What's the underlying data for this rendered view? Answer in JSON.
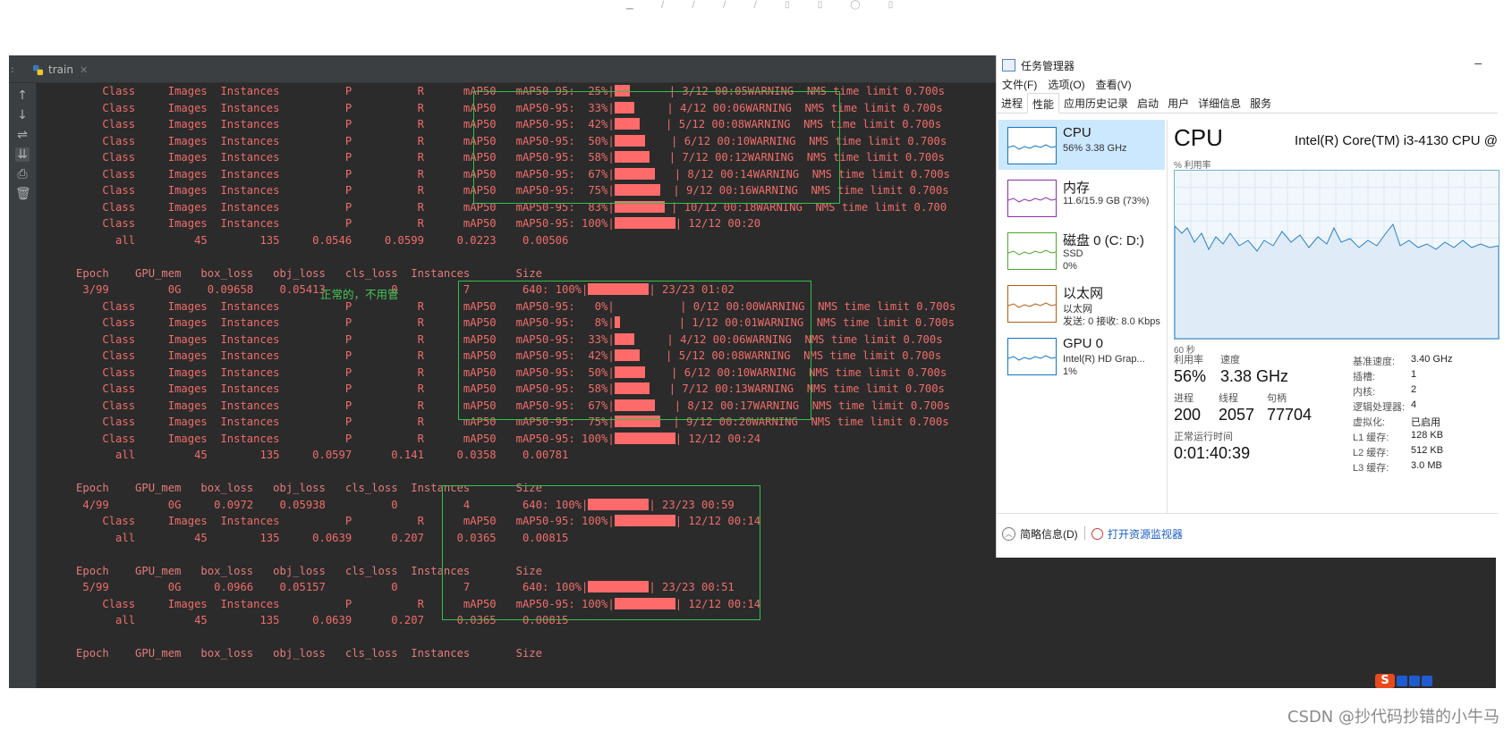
{
  "ide": {
    "tab_label": "train",
    "gutter_icons": [
      "arrow-up-icon",
      "arrow-down-icon",
      "soft-wrap-icon",
      "scroll-to-end-icon",
      "print-icon",
      "trash-icon"
    ]
  },
  "console": {
    "lines": [
      {
        "text": "          Class     Images  Instances          P          R      mAP50   mAP50-95:  25%|",
        "bar": 20,
        "after": "      | 3/12 00:05WARNING  NMS time limit 0.700s"
      },
      {
        "text": "          Class     Images  Instances          P          R      mAP50   mAP50-95:  33%|",
        "bar": 26,
        "after": "     | 4/12 00:06WARNING  NMS time limit 0.700s"
      },
      {
        "text": "          Class     Images  Instances          P          R      mAP50   mAP50-95:  42%|",
        "bar": 33,
        "after": "    | 5/12 00:08WARNING  NMS time limit 0.700s"
      },
      {
        "text": "          Class     Images  Instances          P          R      mAP50   mAP50-95:  50%|",
        "bar": 40,
        "after": "    | 6/12 00:10WARNING  NMS time limit 0.700s"
      },
      {
        "text": "          Class     Images  Instances          P          R      mAP50   mAP50-95:  58%|",
        "bar": 46,
        "after": "   | 7/12 00:12WARNING  NMS time limit 0.700s"
      },
      {
        "text": "          Class     Images  Instances          P          R      mAP50   mAP50-95:  67%|",
        "bar": 53,
        "after": "   | 8/12 00:14WARNING  NMS time limit 0.700s"
      },
      {
        "text": "          Class     Images  Instances          P          R      mAP50   mAP50-95:  75%|",
        "bar": 60,
        "after": "  | 9/12 00:16WARNING  NMS time limit 0.700s"
      },
      {
        "text": "          Class     Images  Instances          P          R      mAP50   mAP50-95:  83%|",
        "bar": 66,
        "after": " | 10/12 00:18WARNING  NMS time limit 0.700"
      },
      {
        "text": "          Class     Images  Instances          P          R      mAP50   mAP50-95: 100%|",
        "bar": 80,
        "after": "| 12/12 00:20"
      },
      {
        "text": "            all         45        135     0.0546     0.0599     0.0223    0.00506",
        "bar": 0,
        "after": ""
      },
      {
        "text": "",
        "bar": 0,
        "after": ""
      },
      {
        "text": "      Epoch    GPU_mem   box_loss   obj_loss   cls_loss  Instances       Size",
        "bar": 0,
        "after": "",
        "head": true
      },
      {
        "text": "       3/99         0G    0.09658    0.05413          0          7        640: 100%|",
        "bar": 80,
        "after": "| 23/23 01:02"
      },
      {
        "text": "          Class     Images  Instances          P          R      mAP50   mAP50-95:   0%|",
        "bar": 0,
        "after": "          | 0/12 00:00WARNING  NMS time limit 0.700s"
      },
      {
        "text": "          Class     Images  Instances          P          R      mAP50   mAP50-95:   8%|",
        "bar": 7,
        "after": "         | 1/12 00:01WARNING  NMS time limit 0.700s"
      },
      {
        "text": "          Class     Images  Instances          P          R      mAP50   mAP50-95:  33%|",
        "bar": 26,
        "after": "     | 4/12 00:06WARNING  NMS time limit 0.700s"
      },
      {
        "text": "          Class     Images  Instances          P          R      mAP50   mAP50-95:  42%|",
        "bar": 33,
        "after": "    | 5/12 00:08WARNING  NMS time limit 0.700s"
      },
      {
        "text": "          Class     Images  Instances          P          R      mAP50   mAP50-95:  50%|",
        "bar": 40,
        "after": "    | 6/12 00:10WARNING  NMS time limit 0.700s"
      },
      {
        "text": "          Class     Images  Instances          P          R      mAP50   mAP50-95:  58%|",
        "bar": 46,
        "after": "   | 7/12 00:13WARNING  NMS time limit 0.700s"
      },
      {
        "text": "          Class     Images  Instances          P          R      mAP50   mAP50-95:  67%|",
        "bar": 53,
        "after": "   | 8/12 00:17WARNING  NMS time limit 0.700s"
      },
      {
        "text": "          Class     Images  Instances          P          R      mAP50   mAP50-95:  75%|",
        "bar": 60,
        "after": "  | 9/12 00:20WARNING  NMS time limit 0.700s"
      },
      {
        "text": "          Class     Images  Instances          P          R      mAP50   mAP50-95: 100%|",
        "bar": 80,
        "after": "| 12/12 00:24"
      },
      {
        "text": "            all         45        135     0.0597      0.141     0.0358    0.00781",
        "bar": 0,
        "after": ""
      },
      {
        "text": "",
        "bar": 0,
        "after": ""
      },
      {
        "text": "      Epoch    GPU_mem   box_loss   obj_loss   cls_loss  Instances       Size",
        "bar": 0,
        "after": "",
        "head": true
      },
      {
        "text": "       4/99         0G     0.0972    0.05938          0          4        640: 100%|",
        "bar": 80,
        "after": "| 23/23 00:59"
      },
      {
        "text": "          Class     Images  Instances          P          R      mAP50   mAP50-95: 100%|",
        "bar": 80,
        "after": "| 12/12 00:14"
      },
      {
        "text": "            all         45        135     0.0639      0.207     0.0365    0.00815",
        "bar": 0,
        "after": ""
      },
      {
        "text": "",
        "bar": 0,
        "after": ""
      },
      {
        "text": "      Epoch    GPU_mem   box_loss   obj_loss   cls_loss  Instances       Size",
        "bar": 0,
        "after": "",
        "head": true
      },
      {
        "text": "       5/99         0G     0.0966    0.05157          0          7        640: 100%|",
        "bar": 80,
        "after": "| 23/23 00:51"
      },
      {
        "text": "          Class     Images  Instances          P          R      mAP50   mAP50-95: 100%|",
        "bar": 80,
        "after": "| 12/12 00:14"
      },
      {
        "text": "            all         45        135     0.0639      0.207     0.0365    0.00815",
        "bar": 0,
        "after": ""
      },
      {
        "text": "",
        "bar": 0,
        "after": ""
      },
      {
        "text": "      Epoch    GPU_mem   box_loss   obj_loss   cls_loss  Instances       Size",
        "bar": 0,
        "after": "",
        "head": true
      }
    ],
    "annotation": "正常的，不用管"
  },
  "task_manager": {
    "title": "任务管理器",
    "menu": [
      "文件(F)",
      "选项(O)",
      "查看(V)"
    ],
    "tabs": [
      "进程",
      "性能",
      "应用历史记录",
      "启动",
      "用户",
      "详细信息",
      "服务"
    ],
    "active_tab": "性能",
    "resources": [
      {
        "name": "CPU",
        "line2": "56% 3.38 GHz",
        "line3": "",
        "color": "#1174c3",
        "active": true
      },
      {
        "name": "内存",
        "line2": "11.6/15.9 GB (73%)",
        "line3": "",
        "color": "#8b2fa8",
        "active": false
      },
      {
        "name": "磁盘 0 (C: D:)",
        "line2": "SSD",
        "line3": "0%",
        "color": "#4ca82a",
        "active": false
      },
      {
        "name": "以太网",
        "line2": "以太网",
        "line3": "发送: 0 接收: 8.0 Kbps",
        "color": "#b35a12",
        "active": false
      },
      {
        "name": "GPU 0",
        "line2": "Intel(R) HD Grap...",
        "line3": "1%",
        "color": "#1174c3",
        "active": false
      }
    ],
    "cpu": {
      "heading": "CPU",
      "model": "Intel(R) Core(TM) i3-4130 CPU @",
      "util_label": "% 利用率",
      "seconds_label": "60 秒",
      "stats": {
        "util_label": "利用率",
        "util": "56%",
        "speed_label": "速度",
        "speed": "3.38 GHz",
        "proc_label": "进程",
        "proc": "200",
        "thread_label": "线程",
        "thread": "2057",
        "handle_label": "句柄",
        "handle": "77704",
        "uptime_label": "正常运行时间",
        "uptime": "0:01:40:39"
      },
      "specs": [
        {
          "k": "基准速度:",
          "v": "3.40 GHz"
        },
        {
          "k": "插槽:",
          "v": "1"
        },
        {
          "k": "内核:",
          "v": "2"
        },
        {
          "k": "逻辑处理器:",
          "v": "4"
        },
        {
          "k": "虚拟化:",
          "v": "已启用"
        },
        {
          "k": "L1 缓存:",
          "v": "128 KB"
        },
        {
          "k": "L2 缓存:",
          "v": "512 KB"
        },
        {
          "k": "L3 缓存:",
          "v": "3.0 MB"
        }
      ]
    },
    "bottom": {
      "summary": "简略信息(D)",
      "monitor": "打开资源监视器"
    }
  },
  "ime_label": "S",
  "watermark": "CSDN @抄代码抄错的小牛马"
}
